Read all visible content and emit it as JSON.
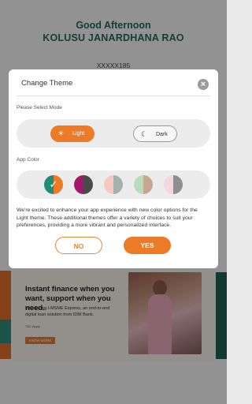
{
  "background": {
    "greeting": "Good Afternoon",
    "user_name": "KOLUSU JANARDHANA RAO",
    "account_number": "XXXXX185",
    "banner": {
      "headline": "Instant finance when you want, support when you need.",
      "body": "Introducing I-MSME Express, an end-to-end digital loan solution from IDBI Bank.",
      "tc": "T&C Apply",
      "cta": "KNOW MORE"
    }
  },
  "modal": {
    "title": "Change Theme",
    "close_icon": "close-icon",
    "mode_label": "Please Select Mode",
    "modes": [
      {
        "label": "Light",
        "icon": "sun-icon",
        "selected": true
      },
      {
        "label": "Dark",
        "icon": "moon-icon",
        "selected": false
      }
    ],
    "color_label": "App Color",
    "swatches": [
      {
        "left": "#1f8c76",
        "right": "#ec7a26",
        "selected": true
      },
      {
        "left": "#a4186b",
        "right": "#4a4a4a",
        "selected": false
      },
      {
        "left": "#f7c8c0",
        "right": "#a4b1ad",
        "selected": false
      },
      {
        "left": "#b9dcbf",
        "right": "#c7a58e",
        "selected": false
      },
      {
        "left": "#f2d7dc",
        "right": "#8f8f8f",
        "selected": false
      }
    ],
    "description": "We're excited to enhance your app experience with new color options for the Light theme. These additional themes offer a variety of choices to suit your preferences, providing a more vibrant and personalized interface.",
    "no_label": "NO",
    "yes_label": "YES"
  },
  "colors": {
    "accent": "#ec7a26",
    "brand_green": "#1e6b5a"
  }
}
